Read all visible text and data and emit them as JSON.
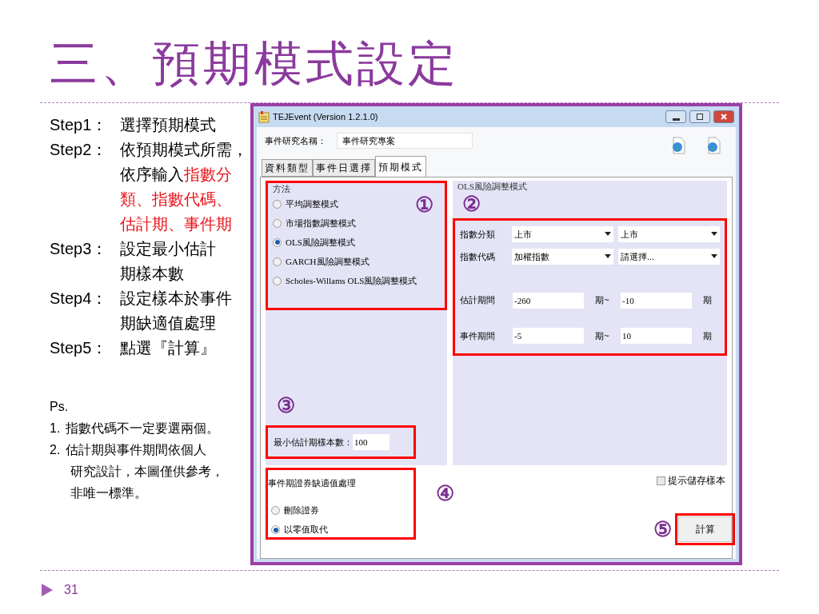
{
  "slide": {
    "title": "三、預期模式設定",
    "steps": [
      {
        "label": "Step1：",
        "lines": [
          [
            {
              "text": "選擇預期模式",
              "highlight": false
            }
          ]
        ]
      },
      {
        "label": "Step2：",
        "lines": [
          [
            {
              "text": "依預期模式所需，",
              "highlight": false
            }
          ],
          [
            {
              "text": "依序輸入",
              "highlight": false
            },
            {
              "text": "指數分",
              "highlight": true
            }
          ],
          [
            {
              "text": "類、指數代碼、",
              "highlight": true
            }
          ],
          [
            {
              "text": "估計期、事件期",
              "highlight": true
            }
          ]
        ]
      },
      {
        "label": "Step3：",
        "lines": [
          [
            {
              "text": "設定最小估計",
              "highlight": false
            }
          ],
          [
            {
              "text": "期樣本數",
              "highlight": false
            }
          ]
        ]
      },
      {
        "label": "Step4：",
        "lines": [
          [
            {
              "text": "設定樣本於事件",
              "highlight": false
            }
          ],
          [
            {
              "text": "期缺適值處理",
              "highlight": false
            }
          ]
        ]
      },
      {
        "label": "Step5：",
        "lines": [
          [
            {
              "text": "點選『計算』",
              "highlight": false
            }
          ]
        ]
      }
    ],
    "notes_title": "Ps.",
    "notes": [
      {
        "label": "1.",
        "lines": [
          "指數代碼不一定要選兩個。"
        ]
      },
      {
        "label": "2.",
        "lines": [
          "估計期與事件期間依個人",
          "研究設計，本圖僅供參考，",
          "非唯一標準。"
        ]
      }
    ],
    "page_number": "31"
  },
  "window": {
    "title": "TEJEvent (Version 1.2.1.0)",
    "project_label": "事件研究名稱：",
    "project_name": "事件研究專案",
    "tabs": [
      {
        "label": "資料類型",
        "selected": false
      },
      {
        "label": "事件日選擇",
        "selected": false
      },
      {
        "label": "預期模式",
        "selected": true
      }
    ],
    "method_group": {
      "title": "方法",
      "callout": "①",
      "options": [
        {
          "label": "平均調整模式",
          "selected": false
        },
        {
          "label": "市場指數調整模式",
          "selected": false
        },
        {
          "label": "OLS風險調整模式",
          "selected": true
        },
        {
          "label": "GARCH風險調整模式",
          "selected": false
        },
        {
          "label": "Scholes-Willams OLS風險調整模式",
          "selected": false
        }
      ]
    },
    "min_samples": {
      "callout": "③",
      "label": "最小估計期樣本數：",
      "value": "100"
    },
    "model_group": {
      "title": "OLS風險調整模式",
      "callout": "②",
      "dropdown_rows": [
        {
          "label": "指數分類",
          "values": [
            "上市",
            "上市"
          ]
        },
        {
          "label": "指數代碼",
          "values": [
            "加權指數",
            "請選擇..."
          ]
        }
      ],
      "period_rows": [
        {
          "label": "估計期間",
          "from": "-260",
          "separator": "期~",
          "to": "-10",
          "unit": "期"
        },
        {
          "label": "事件期間",
          "from": "-5",
          "separator": "期~",
          "to": "10",
          "unit": "期"
        }
      ]
    },
    "missing_group": {
      "title": "事件期證券缺適值處理",
      "callout": "④",
      "options": [
        {
          "label": "刪除證券",
          "selected": false
        },
        {
          "label": "以零值取代",
          "selected": true
        }
      ]
    },
    "save_prompt": {
      "label": "提示儲存樣本",
      "checked": false
    },
    "calculate": {
      "callout": "⑤",
      "label": "計算"
    }
  }
}
